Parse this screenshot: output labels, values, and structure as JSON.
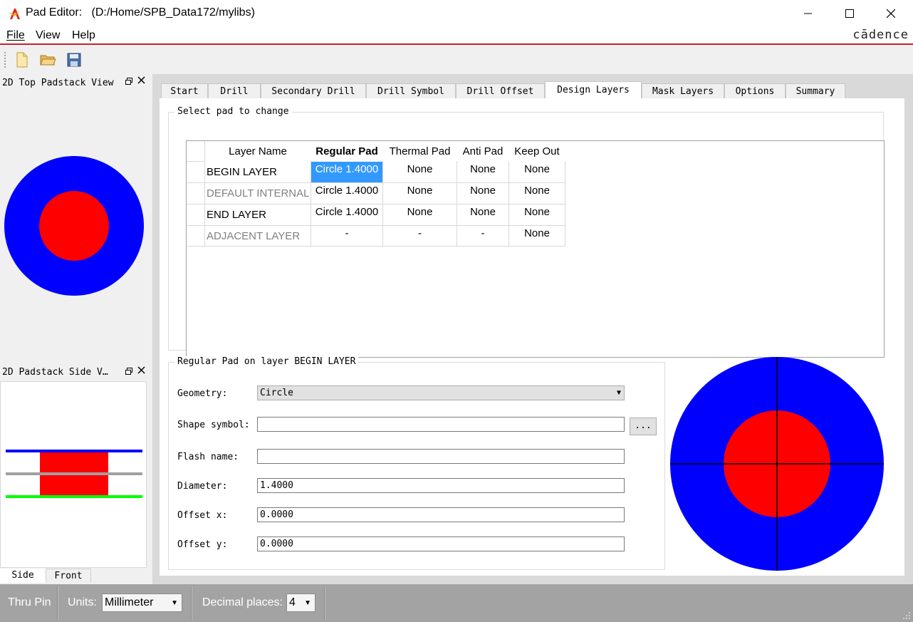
{
  "window": {
    "title": "Pad Editor:   (D:/Home/SPB_Data172/mylibs)",
    "minimize_glyph": "—",
    "maximize_glyph": "☐",
    "close_glyph": "✕"
  },
  "menu": {
    "items": [
      "File",
      "View",
      "Help"
    ],
    "brand": "cādence"
  },
  "toolbar": {
    "icons": [
      "new-file-icon",
      "open-folder-icon",
      "save-icon"
    ]
  },
  "dock": {
    "top_view_title": "2D Top Padstack View",
    "side_view_title": "2D Padstack Side V…",
    "float_glyph": "Ὕ7",
    "close_glyph": "✕",
    "side_tabs": [
      "Side",
      "Front"
    ]
  },
  "tabs": [
    "Start",
    "Drill",
    "Secondary Drill",
    "Drill Symbol",
    "Drill Offset",
    "Design Layers",
    "Mask Layers",
    "Options",
    "Summary"
  ],
  "active_tab": "Design Layers",
  "select_group": {
    "title": "Select pad to change",
    "columns": [
      "Layer Name",
      "Regular Pad",
      "Thermal Pad",
      "Anti Pad",
      "Keep Out"
    ],
    "rows": [
      {
        "layer": "BEGIN LAYER",
        "regular": "Circle 1.4000",
        "thermal": "None",
        "anti": "None",
        "keepout": "None",
        "dimmed": false,
        "selected": true
      },
      {
        "layer": "DEFAULT INTERNAL",
        "regular": "Circle 1.4000",
        "thermal": "None",
        "anti": "None",
        "keepout": "None",
        "dimmed": true,
        "selected": false
      },
      {
        "layer": "END LAYER",
        "regular": "Circle 1.4000",
        "thermal": "None",
        "anti": "None",
        "keepout": "None",
        "dimmed": false,
        "selected": false
      },
      {
        "layer": "ADJACENT LAYER",
        "regular": "-",
        "thermal": "-",
        "anti": "-",
        "keepout": "None",
        "dimmed": true,
        "selected": false
      }
    ]
  },
  "pad_group": {
    "title": "Regular Pad on layer BEGIN LAYER",
    "geometry_label": "Geometry:",
    "geometry_value": "Circle",
    "shape_symbol_label": "Shape symbol:",
    "shape_symbol_value": "",
    "browse_label": "...",
    "flash_name_label": "Flash name:",
    "flash_name_value": "",
    "diameter_label": "Diameter:",
    "diameter_value": "1.4000",
    "offset_x_label": "Offset x:",
    "offset_x_value": "0.0000",
    "offset_y_label": "Offset y:",
    "offset_y_value": "0.0000"
  },
  "statusbar": {
    "pin_type": "Thru Pin",
    "units_label": "Units:",
    "units_value": "Millimeter",
    "decimal_label": "Decimal places:",
    "decimal_value": "4"
  },
  "colors": {
    "pad_outer": "#0000ff",
    "pad_inner": "#ff0000",
    "selection": "#3399ff",
    "menu_underline": "#c0262d",
    "side_bottom_layer": "#00ff00",
    "side_internal_layer": "#a0a0a0"
  }
}
